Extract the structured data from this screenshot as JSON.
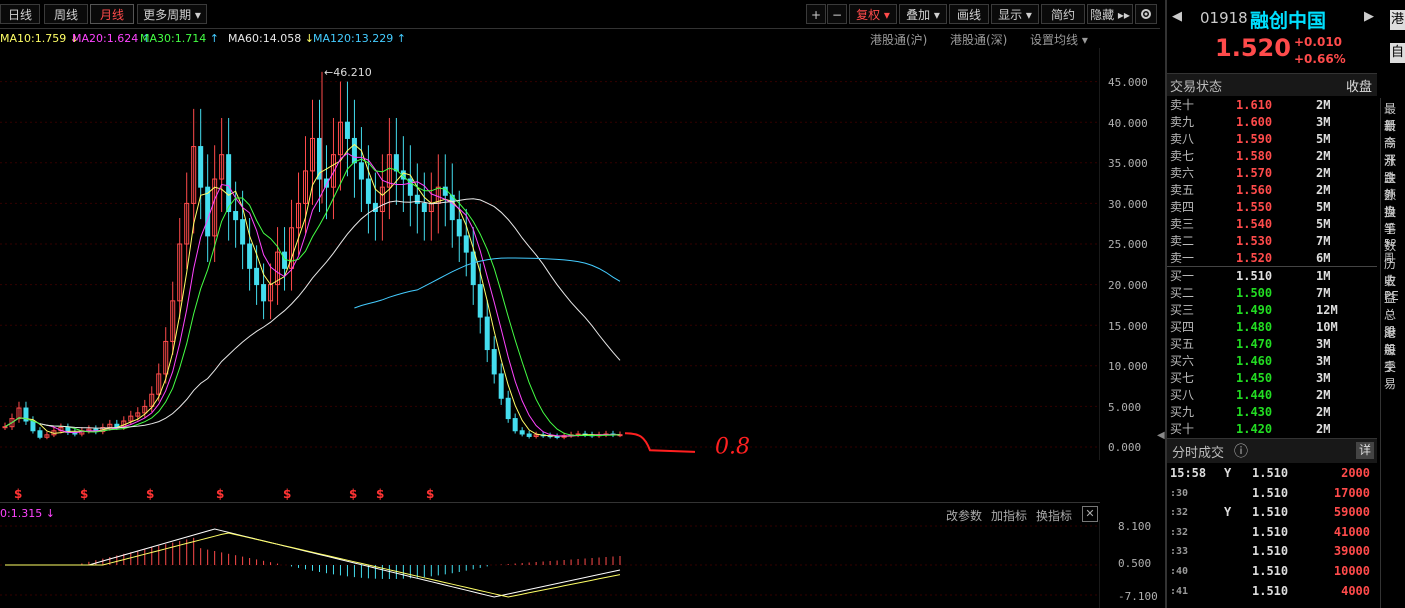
{
  "toolbar": {
    "periods": [
      "日线",
      "周线",
      "月线",
      "更多周期 ▾"
    ],
    "active_period": "月线",
    "right_buttons": [
      "+",
      "−",
      "复权 ▾",
      "叠加 ▾",
      "画线",
      "显示 ▾",
      "简约",
      "隐藏 ▸▸"
    ],
    "settings_icon": "gear-icon"
  },
  "ma_legend": [
    {
      "label": "MA10:1.759",
      "arrow": "↓",
      "color": "#ffff66"
    },
    {
      "label": "MA20:1.624",
      "arrow": "↑",
      "color": "#ff44ff"
    },
    {
      "label": "MA30:1.714",
      "arrow": "↑",
      "color": "#44ff44"
    },
    {
      "label": "MA60:14.058",
      "arrow": "↓",
      "color": "#e8e8e8"
    },
    {
      "label": "MA120:13.229",
      "arrow": "↑",
      "color": "#44ccff"
    }
  ],
  "links": [
    "港股通(沪)",
    "港股通(深)",
    "设置均线 ▾"
  ],
  "price_axis": [
    "45.000",
    "40.000",
    "35.000",
    "30.000",
    "25.000",
    "20.000",
    "15.000",
    "10.000",
    "5.000",
    "0.000"
  ],
  "peak_label": "←46.210",
  "annotation": "0.8",
  "dividend_marker": "$",
  "indicator": {
    "legend": "0:1.315 ↓",
    "buttons": [
      "改参数",
      "加指标",
      "换指标"
    ],
    "close": "✕",
    "axis": [
      "8.100",
      "0.500",
      "-7.100"
    ]
  },
  "stock": {
    "code": "01918",
    "name": "融创中国",
    "price": "1.520",
    "change": "+0.010",
    "change_pct": "+0.66%",
    "edge_tag": "港",
    "edge_tag2": "自"
  },
  "trading": {
    "title": "交易状态",
    "status": "收盘"
  },
  "asks": [
    {
      "label": "卖十",
      "price": "1.610",
      "vol": "2M"
    },
    {
      "label": "卖九",
      "price": "1.600",
      "vol": "3M"
    },
    {
      "label": "卖八",
      "price": "1.590",
      "vol": "5M"
    },
    {
      "label": "卖七",
      "price": "1.580",
      "vol": "2M"
    },
    {
      "label": "卖六",
      "price": "1.570",
      "vol": "2M"
    },
    {
      "label": "卖五",
      "price": "1.560",
      "vol": "2M"
    },
    {
      "label": "卖四",
      "price": "1.550",
      "vol": "5M"
    },
    {
      "label": "卖三",
      "price": "1.540",
      "vol": "5M"
    },
    {
      "label": "卖二",
      "price": "1.530",
      "vol": "7M"
    },
    {
      "label": "卖一",
      "price": "1.520",
      "vol": "6M"
    }
  ],
  "bids": [
    {
      "label": "买一",
      "price": "1.510",
      "vol": "1M"
    },
    {
      "label": "买二",
      "price": "1.500",
      "vol": "7M"
    },
    {
      "label": "买三",
      "price": "1.490",
      "vol": "12M"
    },
    {
      "label": "买四",
      "price": "1.480",
      "vol": "10M"
    },
    {
      "label": "买五",
      "price": "1.470",
      "vol": "3M"
    },
    {
      "label": "买六",
      "price": "1.460",
      "vol": "3M"
    },
    {
      "label": "买七",
      "price": "1.450",
      "vol": "3M"
    },
    {
      "label": "买八",
      "price": "1.440",
      "vol": "2M"
    },
    {
      "label": "买九",
      "price": "1.430",
      "vol": "2M"
    },
    {
      "label": "买十",
      "price": "1.420",
      "vol": "2M"
    }
  ],
  "ticks_header": {
    "title": "分时成交",
    "info": "ⓘ",
    "detail": "详"
  },
  "ticks": [
    {
      "time": "15:58",
      "flag": "Y",
      "price": "1.510",
      "vol": "2000"
    },
    {
      "time": ":30",
      "flag": "",
      "price": "1.510",
      "vol": "17000"
    },
    {
      "time": ":32",
      "flag": "Y",
      "price": "1.510",
      "vol": "59000"
    },
    {
      "time": ":32",
      "flag": "",
      "price": "1.510",
      "vol": "41000"
    },
    {
      "time": ":33",
      "flag": "",
      "price": "1.510",
      "vol": "39000"
    },
    {
      "time": ":40",
      "flag": "",
      "price": "1.510",
      "vol": "10000"
    },
    {
      "time": ":41",
      "flag": "",
      "price": "1.510",
      "vol": "4000"
    }
  ],
  "edge_labels": [
    "最新",
    "最高",
    "今开",
    "涨跌",
    "金额",
    "外盘",
    "换手",
    "笔数",
    "52周",
    "历史",
    "收益",
    "PE",
    "总股",
    "港股",
    "每手",
    "交易"
  ],
  "colors": {
    "up": "#ff4b4b",
    "down": "#22dd22",
    "candle_down": "#44ddee",
    "accent": "#00e0ff"
  }
}
